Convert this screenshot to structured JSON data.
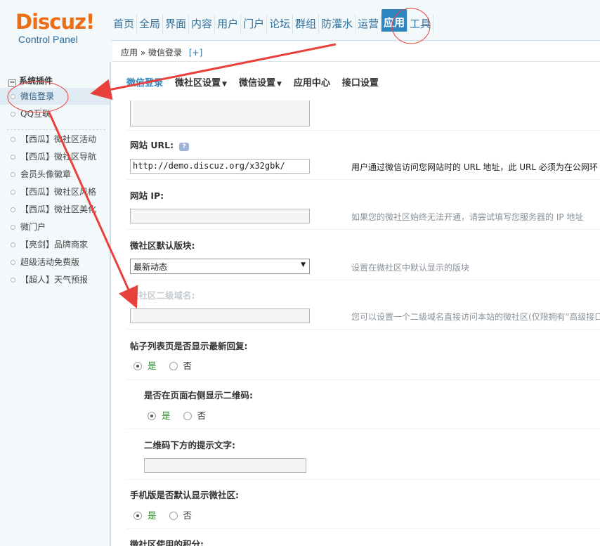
{
  "logo": {
    "brand": "Discuz!",
    "sub": "Control Panel"
  },
  "topnav": {
    "items": [
      "首页",
      "全局",
      "界面",
      "内容",
      "用户",
      "门户",
      "论坛",
      "群组",
      "防灌水",
      "运营",
      "应用",
      "工具"
    ],
    "active_index": 10
  },
  "breadcrumb": {
    "section": "应用",
    "separator": "»",
    "page": "微信登录",
    "add": "[+]"
  },
  "sidebar": {
    "heading": "系统插件",
    "items": [
      {
        "label": "微信登录",
        "active": true
      },
      {
        "label": "QQ互联"
      },
      {
        "label": "【西瓜】微社区活动"
      },
      {
        "label": "【西瓜】微社区导航"
      },
      {
        "label": "会员头像徽章"
      },
      {
        "label": "【西瓜】微社区风格"
      },
      {
        "label": "【西瓜】微社区美化"
      },
      {
        "label": "微门户"
      },
      {
        "label": "【亮剑】品牌商家"
      },
      {
        "label": "超级活动免费版"
      },
      {
        "label": "【超人】天气预报"
      }
    ]
  },
  "tabs": [
    {
      "label": "微信登录",
      "active": true
    },
    {
      "label": "微社区设置",
      "dropdown": true
    },
    {
      "label": "微信设置",
      "dropdown": true
    },
    {
      "label": "应用中心"
    },
    {
      "label": "接口设置"
    }
  ],
  "form": {
    "site_url": {
      "label": "网站 URL:",
      "value": "http://demo.discuz.org/x32gbk/",
      "tip": "用户通过微信访问您网站时的 URL 地址，此 URL 必须为在公网环"
    },
    "site_ip": {
      "label": "网站 IP:",
      "value": "",
      "tip": "如果您的微社区始终无法开通，请尝试填写您服务器的 IP 地址"
    },
    "default_forum": {
      "label": "微社区默认版块:",
      "value": "最新动态",
      "tip": "设置在微社区中默认显示的版块"
    },
    "subdomain": {
      "label": "微社区二级域名:",
      "value": "",
      "tip": "您可以设置一个二级域名直接访问本站的微社区(仅限拥有\"高级接口"
    },
    "show_reply": {
      "label": "帖子列表页是否显示最新回复:",
      "yes": "是",
      "no": "否",
      "selected": "yes"
    },
    "show_qrcode": {
      "label": "是否在页面右侧显示二维码:",
      "yes": "是",
      "no": "否",
      "selected": "yes"
    },
    "qrcode_tip": {
      "label": "二维码下方的提示文字:",
      "value": ""
    },
    "mobile_default": {
      "label": "手机版是否默认显示微社区:",
      "yes": "是",
      "no": "否",
      "selected": "yes"
    },
    "credits": {
      "label": "微社区使用的积分:"
    }
  },
  "colors": {
    "accent": "#2e86c1",
    "logo": "#ec6d13",
    "annotation": "#e8413c"
  }
}
